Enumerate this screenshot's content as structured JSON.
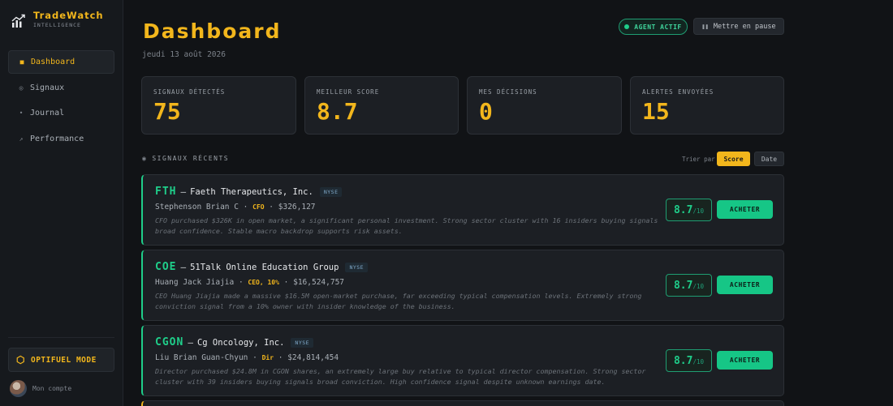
{
  "brand": {
    "title": "TradeWatch",
    "subtitle": "INTELLIGENCE"
  },
  "nav": [
    {
      "label": "Dashboard",
      "icon": "square-icon",
      "active": true
    },
    {
      "label": "Signaux",
      "icon": "circle-icon",
      "active": false
    },
    {
      "label": "Journal",
      "icon": "dot-icon",
      "active": false
    },
    {
      "label": "Performance",
      "icon": "trend-icon",
      "active": false
    }
  ],
  "opt_mode": {
    "label": "OPTIFUEL MODE"
  },
  "account": {
    "label": "Mon compte"
  },
  "header": {
    "title": "Dashboard",
    "date": "jeudi 13 août 2026",
    "agent_status": "AGENT ACTIF",
    "pause_label": "Mettre en pause"
  },
  "stats": [
    {
      "label": "SIGNAUX DÉTECTÉS",
      "value": "75"
    },
    {
      "label": "MEILLEUR SCORE",
      "value": "8.7"
    },
    {
      "label": "MES DÉCISIONS",
      "value": "0"
    },
    {
      "label": "ALERTES ENVOYÉES",
      "value": "15"
    }
  ],
  "signals_section": {
    "title": "SIGNAUX RÉCENTS",
    "sort_label": "Trier par",
    "sort_options": [
      "Score",
      "Date"
    ],
    "sort_active": "Score"
  },
  "signals": [
    {
      "ticker": "FTH",
      "company": "Faeth Therapeutics, Inc.",
      "exchange": "NYSE",
      "insider": "Stephenson Brian C",
      "role": "CFO",
      "amount": "$326,127",
      "description": "CFO purchased $326K in open market, a significant personal investment. Strong sector cluster with 16 insiders buying signals broad confidence. Stable macro backdrop supports risk assets.",
      "score": "8.7",
      "score_max": "/10",
      "action": "ACHETER"
    },
    {
      "ticker": "COE",
      "company": "51Talk Online Education Group",
      "exchange": "NYSE",
      "insider": "Huang Jack Jiajia",
      "role": "CEO, 10%",
      "amount": "$16,524,757",
      "description": "CEO Huang Jiajia made a massive $16.5M open-market purchase, far exceeding typical compensation levels. Extremely strong conviction signal from a 10% owner with insider knowledge of the business.",
      "score": "8.7",
      "score_max": "/10",
      "action": "ACHETER"
    },
    {
      "ticker": "CGON",
      "company": "Cg Oncology, Inc.",
      "exchange": "NYSE",
      "insider": "Liu Brian Guan-Chyun",
      "role": "Dir",
      "amount": "$24,814,454",
      "description": "Director purchased $24.8M in CGON shares, an extremely large buy relative to typical director compensation. Strong sector cluster with 39 insiders buying signals broad conviction. High confidence signal despite unknown earnings date.",
      "score": "8.7",
      "score_max": "/10",
      "action": "ACHETER"
    }
  ],
  "colors": {
    "accent": "#f2b61c",
    "success": "#1fce8a",
    "background": "#111316",
    "card": "#1c1f24"
  }
}
